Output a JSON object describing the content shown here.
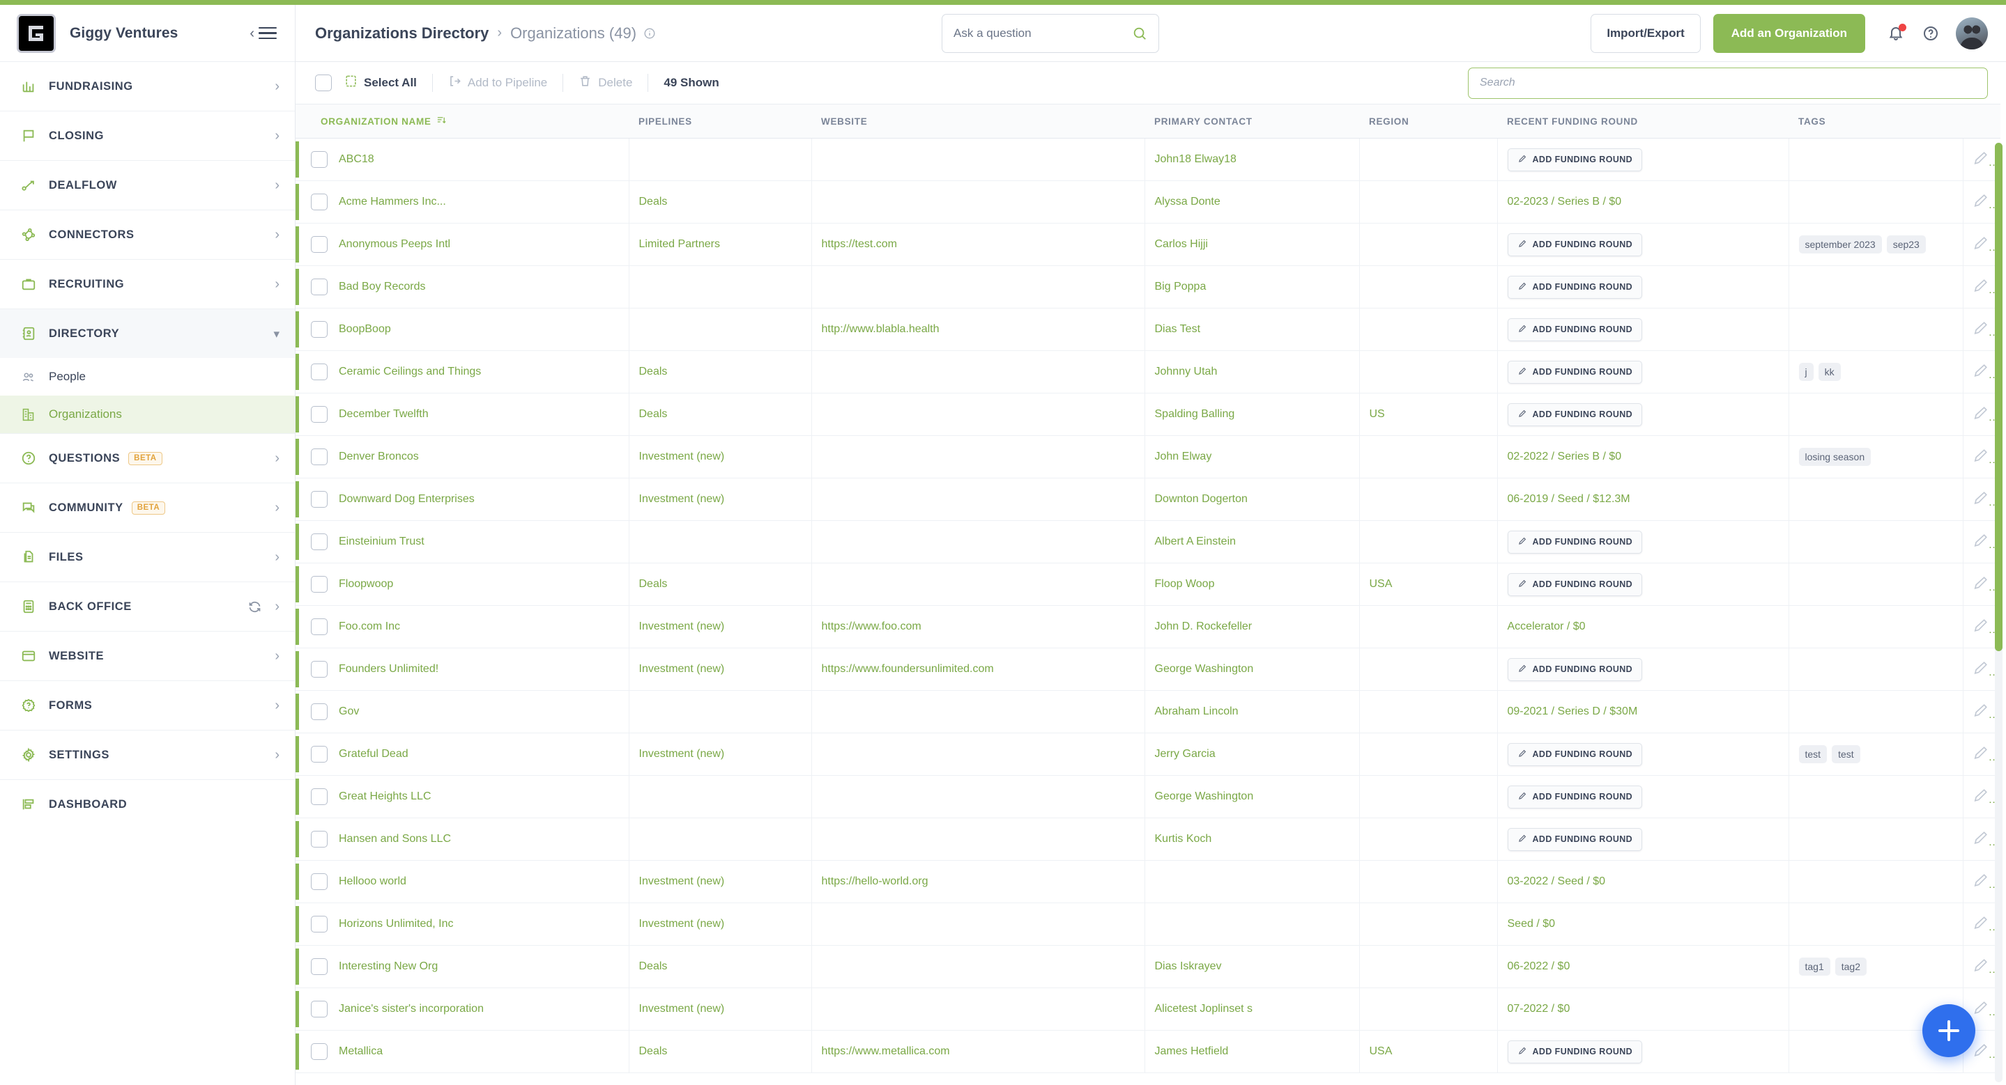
{
  "brand": {
    "name": "Giggy Ventures",
    "logo_letter": "G"
  },
  "sidebar": {
    "groups": [
      {
        "label": "FUNDRAISING",
        "icon": "bar-chart-icon",
        "chevron": "›"
      },
      {
        "label": "CLOSING",
        "icon": "flag-icon",
        "chevron": "›"
      },
      {
        "label": "DEALFLOW",
        "icon": "deal-flow-icon",
        "chevron": "›"
      },
      {
        "label": "CONNECTORS",
        "icon": "network-icon",
        "chevron": "›"
      },
      {
        "label": "RECRUITING",
        "icon": "briefcase-icon",
        "chevron": "›"
      },
      {
        "label": "DIRECTORY",
        "icon": "address-book-icon",
        "chevron": "⌄",
        "open": true
      },
      {
        "label": "QUESTIONS",
        "icon": "question-circle-icon",
        "badge": "BETA",
        "chevron": "›"
      },
      {
        "label": "COMMUNITY",
        "icon": "chat-icon",
        "badge": "BETA",
        "chevron": "›"
      },
      {
        "label": "FILES",
        "icon": "files-icon",
        "chevron": "›"
      },
      {
        "label": "BACK OFFICE",
        "icon": "calculator-icon",
        "sync": true,
        "chevron": "›"
      },
      {
        "label": "WEBSITE",
        "icon": "browser-window-icon",
        "chevron": "›"
      },
      {
        "label": "FORMS",
        "icon": "form-badge-icon",
        "chevron": "›"
      },
      {
        "label": "SETTINGS",
        "icon": "gear-icon",
        "chevron": "›"
      },
      {
        "label": "DASHBOARD",
        "icon": "dashboard-icon"
      }
    ],
    "directory_children": [
      {
        "label": "People",
        "icon": "people-icon",
        "active": false
      },
      {
        "label": "Organizations",
        "icon": "organizations-icon",
        "active": true
      }
    ]
  },
  "header": {
    "breadcrumb_parent": "Organizations Directory",
    "breadcrumb_sep": "›",
    "breadcrumb_current": "Organizations (49)",
    "ask_placeholder": "Ask a question",
    "ask_value": "",
    "import_export_label": "Import/Export",
    "add_organization_label": "Add an Organization"
  },
  "toolbar": {
    "select_all_label": "Select All",
    "add_to_pipeline_label": "Add to Pipeline",
    "delete_label": "Delete",
    "shown_label": "49 Shown",
    "search_placeholder": "Search",
    "search_value": ""
  },
  "table": {
    "columns": [
      "ORGANIZATION NAME",
      "PIPELINES",
      "WEBSITE",
      "PRIMARY CONTACT",
      "REGION",
      "RECENT FUNDING ROUND",
      "TAGS"
    ],
    "sorted_column": "ORGANIZATION NAME",
    "add_funding_round_label": "ADD FUNDING ROUND",
    "rows": [
      {
        "name": "ABC18",
        "pipelines": "",
        "website": "",
        "contact": "John18 Elway18",
        "region": "",
        "funding": "",
        "funding_button": true,
        "tags": []
      },
      {
        "name": "Acme Hammers Inc...",
        "pipelines": "Deals",
        "website": "",
        "contact": "Alyssa Donte",
        "region": "",
        "funding": "02-2023 / Series B / $0",
        "funding_button": false,
        "tags": []
      },
      {
        "name": "Anonymous Peeps Intl",
        "pipelines": "Limited Partners",
        "website": "https://test.com",
        "contact": "Carlos Hijji",
        "region": "",
        "funding": "",
        "funding_button": true,
        "tags": [
          "september 2023",
          "sep23"
        ]
      },
      {
        "name": "Bad Boy Records",
        "pipelines": "",
        "website": "",
        "contact": "Big Poppa",
        "region": "",
        "funding": "",
        "funding_button": true,
        "tags": []
      },
      {
        "name": "BoopBoop",
        "pipelines": "",
        "website": "http://www.blabla.health",
        "contact": "Dias Test",
        "region": "",
        "funding": "",
        "funding_button": true,
        "tags": []
      },
      {
        "name": "Ceramic Ceilings and Things",
        "pipelines": "Deals",
        "website": "",
        "contact": "Johnny Utah",
        "region": "",
        "funding": "",
        "funding_button": true,
        "tags": [
          "j",
          "kk"
        ]
      },
      {
        "name": "December Twelfth",
        "pipelines": "Deals",
        "website": "",
        "contact": "Spalding Balling",
        "region": "US",
        "funding": "",
        "funding_button": true,
        "tags": []
      },
      {
        "name": "Denver Broncos",
        "pipelines": "Investment (new)",
        "website": "",
        "contact": "John Elway",
        "region": "",
        "funding": "02-2022 / Series B / $0",
        "funding_button": false,
        "tags": [
          "losing season"
        ]
      },
      {
        "name": "Downward Dog Enterprises",
        "pipelines": "Investment (new)",
        "website": "",
        "contact": "Downton Dogerton",
        "region": "",
        "funding": "06-2019 / Seed / $12.3M",
        "funding_button": false,
        "tags": []
      },
      {
        "name": "Einsteinium Trust",
        "pipelines": "",
        "website": "",
        "contact": "Albert A Einstein",
        "region": "",
        "funding": "",
        "funding_button": true,
        "tags": []
      },
      {
        "name": "Floopwoop",
        "pipelines": "Deals",
        "website": "",
        "contact": "Floop Woop",
        "region": "USA",
        "funding": "",
        "funding_button": true,
        "tags": []
      },
      {
        "name": "Foo.com Inc",
        "pipelines": "Investment (new)",
        "website": "https://www.foo.com",
        "contact": "John D. Rockefeller",
        "region": "",
        "funding": "Accelerator / $0",
        "funding_button": false,
        "tags": []
      },
      {
        "name": "Founders Unlimited!",
        "pipelines": "Investment (new)",
        "website": "https://www.foundersunlimited.com",
        "contact": "George Washington",
        "region": "",
        "funding": "",
        "funding_button": true,
        "tags": []
      },
      {
        "name": "Gov",
        "pipelines": "",
        "website": "",
        "contact": "Abraham Lincoln",
        "region": "",
        "funding": "09-2021 / Series D / $30M",
        "funding_button": false,
        "tags": []
      },
      {
        "name": "Grateful Dead",
        "pipelines": "Investment (new)",
        "website": "",
        "contact": "Jerry Garcia",
        "region": "",
        "funding": "",
        "funding_button": true,
        "tags": [
          "test",
          "test"
        ]
      },
      {
        "name": "Great Heights LLC",
        "pipelines": "",
        "website": "",
        "contact": "George Washington",
        "region": "",
        "funding": "",
        "funding_button": true,
        "tags": []
      },
      {
        "name": "Hansen and Sons LLC",
        "pipelines": "",
        "website": "",
        "contact": "Kurtis Koch",
        "region": "",
        "funding": "",
        "funding_button": true,
        "tags": []
      },
      {
        "name": "Hellooo world",
        "pipelines": "Investment (new)",
        "website": "https://hello-world.org",
        "contact": "",
        "region": "",
        "funding": "03-2022 / Seed / $0",
        "funding_button": false,
        "tags": []
      },
      {
        "name": "Horizons Unlimited, Inc",
        "pipelines": "Investment (new)",
        "website": "",
        "contact": "",
        "region": "",
        "funding": "Seed / $0",
        "funding_button": false,
        "tags": []
      },
      {
        "name": "Interesting New Org",
        "pipelines": "Deals",
        "website": "",
        "contact": "Dias Iskrayev",
        "region": "",
        "funding": "06-2022 / $0",
        "funding_button": false,
        "tags": [
          "tag1",
          "tag2"
        ]
      },
      {
        "name": "Janice's sister's incorporation",
        "pipelines": "Investment (new)",
        "website": "",
        "contact": "Alicetest Joplinset s",
        "region": "",
        "funding": "07-2022 / $0",
        "funding_button": false,
        "tags": []
      },
      {
        "name": "Metallica",
        "pipelines": "Deals",
        "website": "https://www.metallica.com",
        "contact": "James Hetfield",
        "region": "USA",
        "funding": "",
        "funding_button": true,
        "tags": []
      }
    ]
  },
  "colors": {
    "brand_green": "#8cba55",
    "link_green": "#7aa846",
    "fab_blue": "#2f6fed",
    "notification_red": "#ef4444",
    "beta_amber": "#e2a33c"
  }
}
